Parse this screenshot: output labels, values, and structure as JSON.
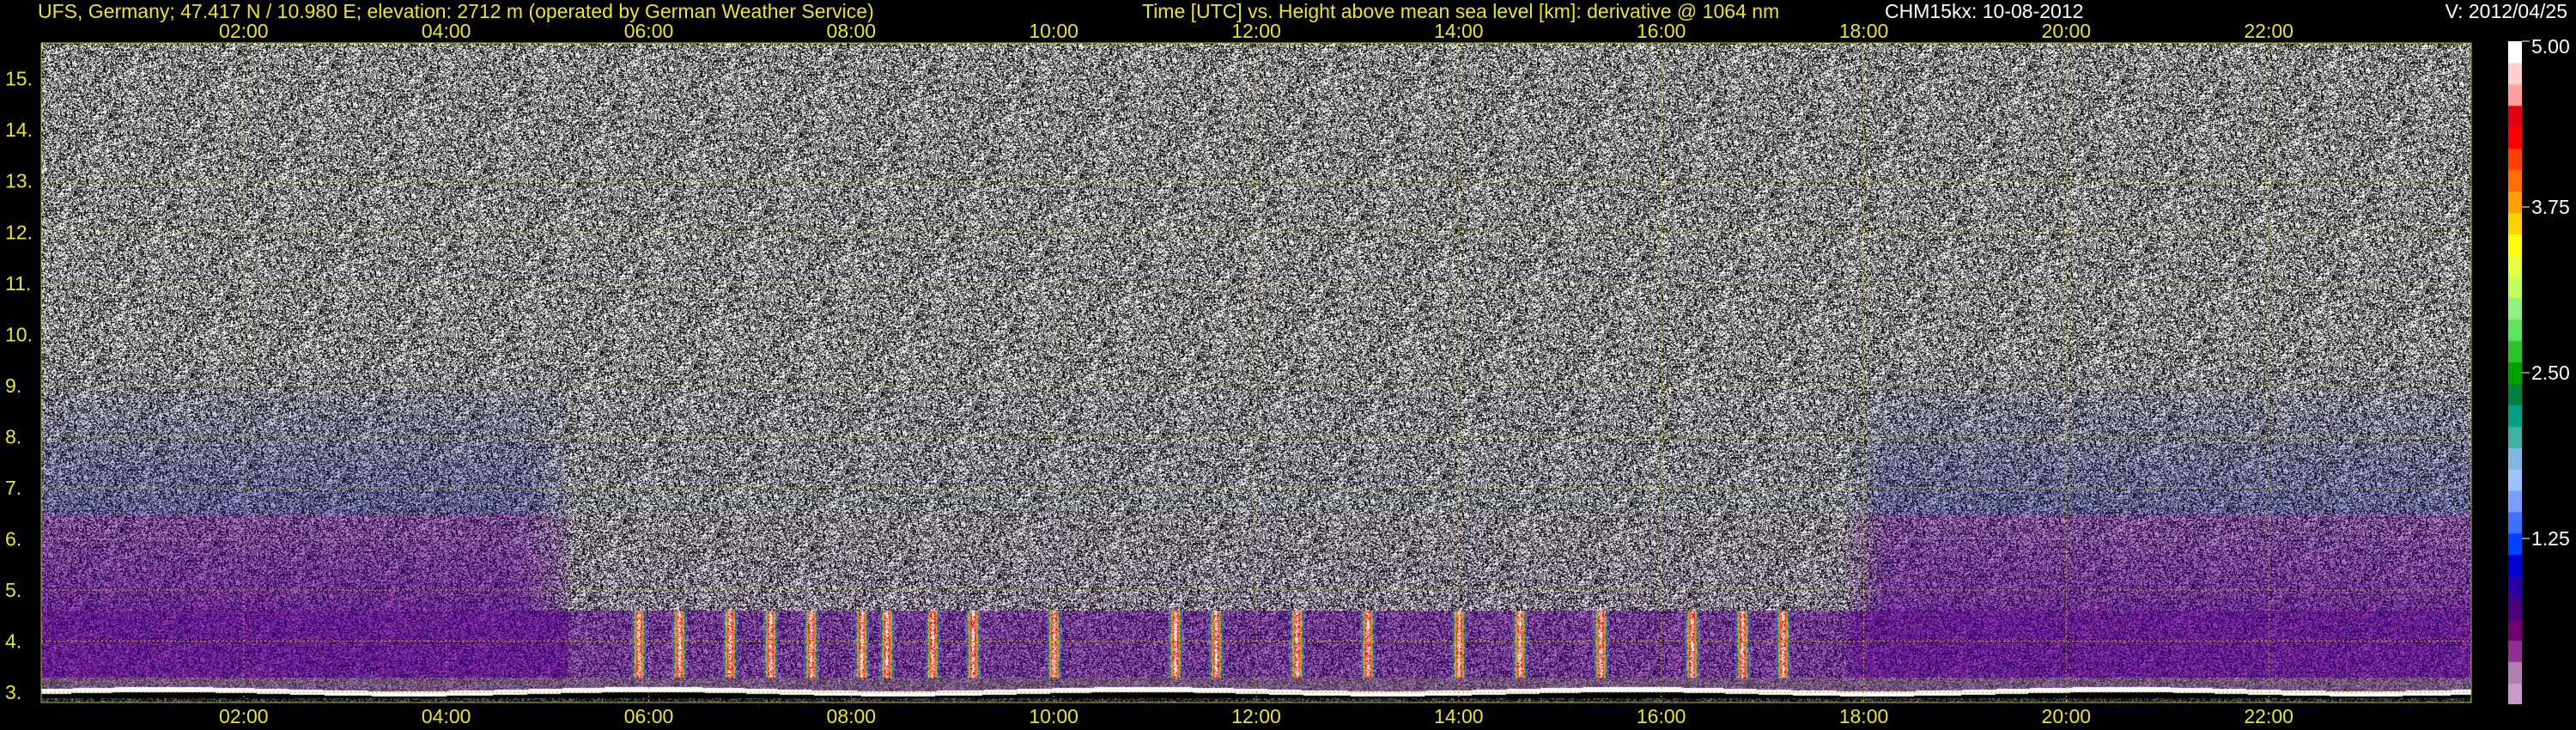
{
  "header": {
    "station": "UFS, Germany; 47.417 N / 10.980 E; elevation: 2712 m  (operated by German Weather Service)",
    "plot_description": "Time [UTC] vs. Height above mean sea level [km]: derivative @ 1064 nm",
    "instrument": "CHM15kx: 10-08-2012",
    "version": "V: 2012/04/25"
  },
  "colors": {
    "background": "#000000",
    "header_text": "#e8e430",
    "axis_text": "#e8e430",
    "grid": "#b0b020"
  },
  "chart_data": {
    "type": "heatmap",
    "x_ticks": [
      "02:00",
      "04:00",
      "06:00",
      "08:00",
      "10:00",
      "12:00",
      "14:00",
      "16:00",
      "18:00",
      "20:00",
      "22:00"
    ],
    "y_ticks": [
      "3",
      "4",
      "5",
      "6",
      "7",
      "8",
      "9",
      "10",
      "11",
      "12",
      "13",
      "14",
      "15"
    ],
    "xlim_hours": [
      0,
      24
    ],
    "ylim_km": [
      2.8,
      15.7
    ],
    "grid": true,
    "colorbar": {
      "ticks": [
        "1.25",
        "2.50",
        "3.75",
        "5.00"
      ],
      "range": [
        0,
        5
      ],
      "colors": [
        "#c89cc8",
        "#b080b0",
        "#903090",
        "#700070",
        "#4a007a",
        "#2a00a0",
        "#0000d0",
        "#0040ff",
        "#4070ff",
        "#7aa0ff",
        "#a0c0ff",
        "#80b8e0",
        "#40b0a0",
        "#00a080",
        "#008040",
        "#00a000",
        "#30c030",
        "#60e060",
        "#90f080",
        "#c0ff60",
        "#e8ff40",
        "#ffff00",
        "#ffd000",
        "#ffa000",
        "#ff7000",
        "#ff4000",
        "#ff0000",
        "#e00010",
        "#ffa0a0",
        "#ffd0d0",
        "#ffffff"
      ]
    }
  }
}
